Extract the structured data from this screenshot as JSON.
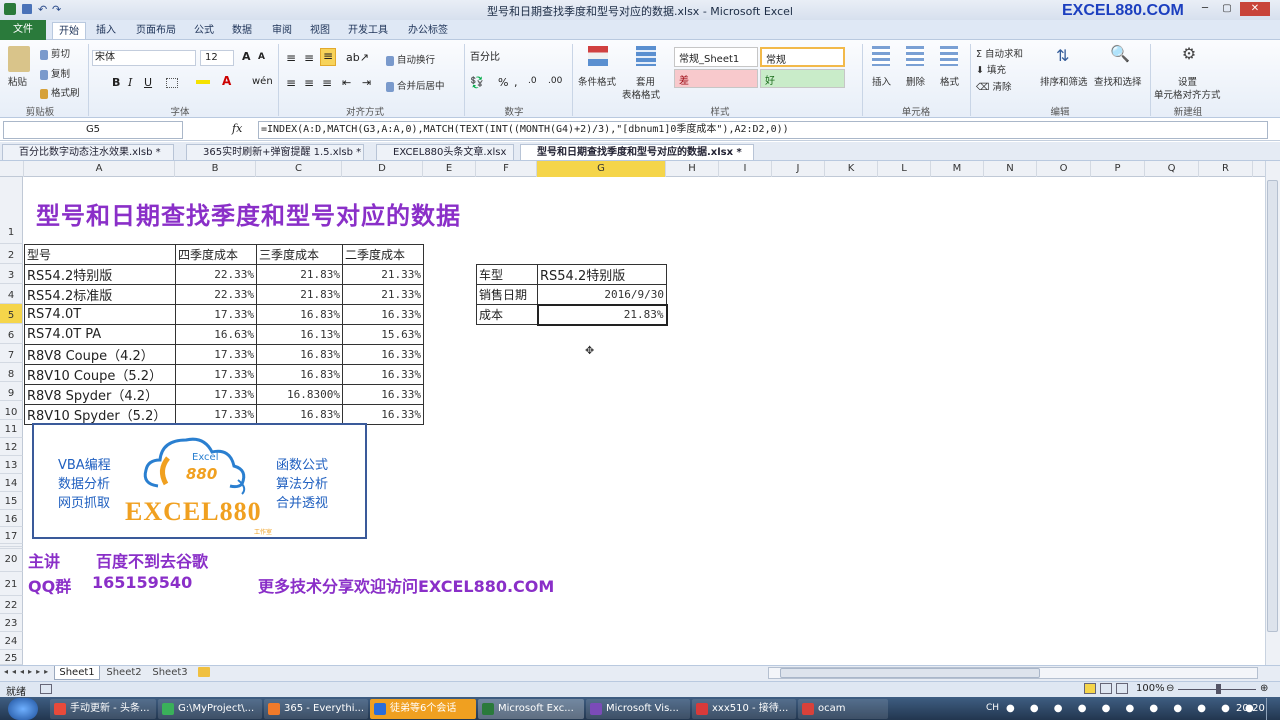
{
  "window": {
    "title": "型号和日期查找季度和型号对应的数据.xlsx - Microsoft Excel",
    "brand": "EXCEL880.COM"
  },
  "ribbon": {
    "tabs": [
      "文件",
      "开始",
      "插入",
      "页面布局",
      "公式",
      "数据",
      "审阅",
      "视图",
      "开发工具",
      "办公标签"
    ],
    "clipboard": {
      "paste": "粘贴",
      "cut": "剪切",
      "copy": "复制",
      "format_painter": "格式刷",
      "label": "剪贴板"
    },
    "font": {
      "name": "宋体",
      "size": "12",
      "label": "字体"
    },
    "alignment": {
      "wrap": "自动换行",
      "merge": "合并后居中",
      "label": "对齐方式"
    },
    "number": {
      "format": "百分比",
      "label": "数字"
    },
    "styles": {
      "conditional": "条件格式",
      "table_format": "套用",
      "table_format2": "表格格式",
      "style1": "常规_Sheet1",
      "style2": "常规",
      "bad": "差",
      "good": "好",
      "label": "样式"
    },
    "cells": {
      "insert": "插入",
      "delete": "删除",
      "format": "格式",
      "label": "单元格"
    },
    "editing": {
      "autosum": "自动求和",
      "fill": "填充",
      "clear": "清除",
      "sort": "排序和筛选",
      "find": "查找和选择",
      "label": "编辑"
    },
    "newgroup": {
      "setting": "设置",
      "setting2": "单元格对齐方式",
      "label": "新建组"
    }
  },
  "formula_bar": {
    "name_box": "G5",
    "fx": "fx",
    "formula": "=INDEX(A:D,MATCH(G3,A:A,0),MATCH(TEXT(INT((MONTH(G4)+2)/3),\"[dbnum1]0季度成本\"),A2:D2,0))"
  },
  "workbook_tabs": [
    "百分比数字动态注水效果.xlsb *",
    "365实时刷新+弹窗提醒 1.5.xlsb *",
    "EXCEL880头条文章.xlsx",
    "型号和日期查找季度和型号对应的数据.xlsx *"
  ],
  "columns": [
    "A",
    "B",
    "C",
    "D",
    "E",
    "F",
    "G",
    "H",
    "I",
    "J",
    "K",
    "L",
    "M",
    "N",
    "O",
    "P",
    "Q",
    "R"
  ],
  "rows": [
    "1",
    "2",
    "3",
    "4",
    "5",
    "6",
    "7",
    "8",
    "9",
    "10",
    "11",
    "12",
    "13",
    "14",
    "15",
    "16",
    "17",
    "18",
    "19",
    "20",
    "21",
    "22",
    "23",
    "24",
    "25"
  ],
  "sheet": {
    "title": "型号和日期查找季度和型号对应的数据",
    "headers": [
      "型号",
      "四季度成本",
      "三季度成本",
      "二季度成本"
    ],
    "table": [
      [
        "RS54.2特别版",
        "22.33%",
        "21.83%",
        "21.33%"
      ],
      [
        "RS54.2标准版",
        "22.33%",
        "21.83%",
        "21.33%"
      ],
      [
        "RS74.0T",
        "17.33%",
        "16.83%",
        "16.33%"
      ],
      [
        "RS74.0T PA",
        "16.63%",
        "16.13%",
        "15.63%"
      ],
      [
        "R8V8 Coupe（4.2）",
        "17.33%",
        "16.83%",
        "16.33%"
      ],
      [
        "R8V10 Coupe（5.2）",
        "17.33%",
        "16.83%",
        "16.33%"
      ],
      [
        "R8V8 Spyder（4.2）",
        "17.33%",
        "16.8300%",
        "16.33%"
      ],
      [
        "R8V10 Spyder（5.2）",
        "17.33%",
        "16.83%",
        "16.33%"
      ]
    ],
    "lookup": [
      {
        "label": "车型",
        "value": "RS54.2特别版"
      },
      {
        "label": "销售日期",
        "value": "2016/9/30"
      },
      {
        "label": "成本",
        "value": "21.83%"
      }
    ],
    "logo": {
      "left1": "VBA编程",
      "left2": "数据分析",
      "left3": "网页抓取",
      "right1": "函数公式",
      "right2": "算法分析",
      "right3": "合并透视",
      "badge1": "Excel",
      "badge2": "880",
      "name": "EXCEL880",
      "sub": "工作室"
    },
    "promo": {
      "speaker_label": "主讲",
      "speaker": "百度不到去谷歌",
      "qq_label": "QQ群",
      "qq": "165159540",
      "visit": "更多技术分享欢迎访问EXCEL880.COM"
    }
  },
  "sheet_tabs": [
    "Sheet1",
    "Sheet2",
    "Sheet3"
  ],
  "status": {
    "ready": "就绪",
    "zoom": "100%"
  },
  "taskbar": {
    "items": [
      "手动更新 - 头条...",
      "G:\\MyProject\\...",
      "365 - Everythi...",
      "徒弟等6个会话",
      "Microsoft Exc...",
      "Microsoft Vis...",
      "xxx510 - 接待...",
      "ocam"
    ],
    "time": "20:20",
    "lang": "CH"
  },
  "colors": {
    "title_purple": "#8a2fc8",
    "excel_green": "#2a7a3b",
    "selected_col": "#f5d54a"
  }
}
